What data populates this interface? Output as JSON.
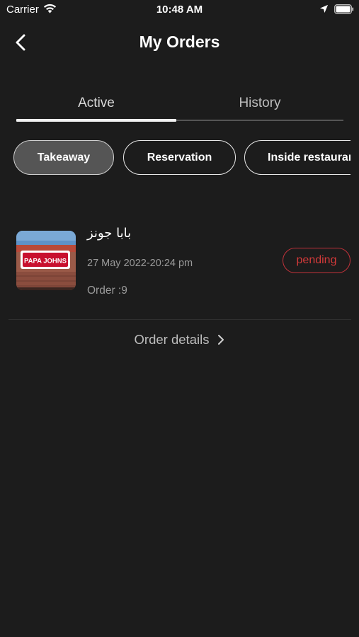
{
  "status_bar": {
    "carrier": "Carrier",
    "time": "10:48 AM"
  },
  "header": {
    "title": "My Orders"
  },
  "tabs": [
    {
      "label": "Active",
      "selected": true
    },
    {
      "label": "History",
      "selected": false
    }
  ],
  "chips": [
    {
      "label": "Takeaway",
      "selected": true
    },
    {
      "label": "Reservation",
      "selected": false
    },
    {
      "label": "Inside restaurant",
      "selected": false
    }
  ],
  "orders": [
    {
      "restaurant_name": "بابا جونز",
      "datetime": "27 May 2022-20:24 pm",
      "order_number": "Order :9",
      "status": "pending",
      "image_sign_text": "PAPA JOHNS"
    }
  ],
  "order_details_label": "Order details",
  "colors": {
    "background": "#1c1c1c",
    "pending_red": "#d43a3a",
    "chip_selected": "#555555"
  }
}
